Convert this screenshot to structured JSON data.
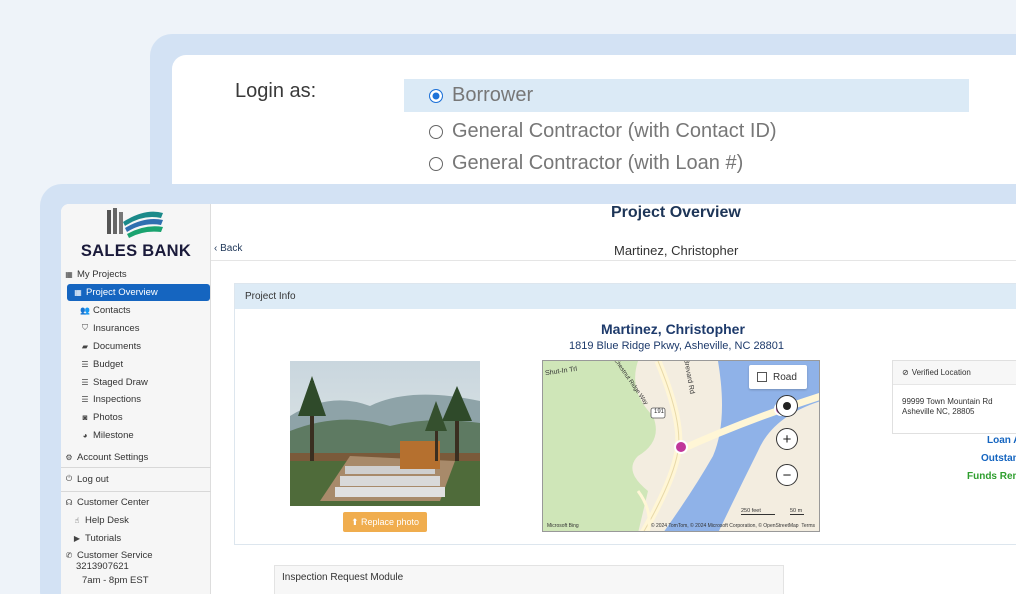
{
  "login": {
    "label": "Login as:",
    "options": [
      {
        "label": "Borrower",
        "selected": true
      },
      {
        "label": "General Contractor (with Contact ID)",
        "selected": false
      },
      {
        "label": "General Contractor (with Loan #)",
        "selected": false
      }
    ]
  },
  "brand": {
    "name": "SALES BANK"
  },
  "sidebar": {
    "items": [
      {
        "label": "My Projects",
        "icon": "grid-icon"
      },
      {
        "label": "Project Overview",
        "icon": "grid-icon",
        "active": true
      },
      {
        "label": "Contacts",
        "icon": "users-icon"
      },
      {
        "label": "Insurances",
        "icon": "shield-icon"
      },
      {
        "label": "Documents",
        "icon": "folder-icon"
      },
      {
        "label": "Budget",
        "icon": "list-icon"
      },
      {
        "label": "Staged Draw",
        "icon": "list-icon"
      },
      {
        "label": "Inspections",
        "icon": "list-icon"
      },
      {
        "label": "Photos",
        "icon": "camera-icon"
      },
      {
        "label": "Milestone",
        "icon": "dashboard-icon"
      },
      {
        "label": "Account Settings",
        "icon": "gear-icon"
      },
      {
        "label": "Log out",
        "icon": "power-icon"
      },
      {
        "label": "Customer Center",
        "icon": "headset-icon"
      },
      {
        "label": "Help Desk",
        "icon": "hand-icon"
      },
      {
        "label": "Tutorials",
        "icon": "play-icon"
      }
    ],
    "customer_service": {
      "label": "Customer Service",
      "phone": "3213907621",
      "hours": "7am - 8pm EST"
    }
  },
  "main": {
    "title": "Project Overview",
    "back_label": "Back",
    "client_name": "Martinez, Christopher"
  },
  "project_info": {
    "header": "Project Info",
    "name": "Martinez, Christopher",
    "address": "1819 Blue Ridge Pkwy, Asheville, NC 28801",
    "replace_photo_label": "Replace photo",
    "map": {
      "road_label": "Road",
      "streets": [
        "Shut-In Trl",
        "Brevard Rd",
        "Chestnut Ridge Way"
      ],
      "route_shield": "191",
      "scale_feet": "250 feet",
      "scale_m": "50 m",
      "provider": "Microsoft Bing",
      "copyright": "© 2024 TomTom, © 2024 Microsoft Corporation, © OpenStreetMap",
      "terms": "Terms"
    },
    "verified": {
      "label": "Verified Location",
      "line1": "99999 Town Mountain Rd",
      "line2": "Asheville NC, 28805"
    },
    "stats": {
      "loan": "Loan A",
      "outstanding": "Outstan",
      "funds": "Funds Rem"
    }
  },
  "inspection": {
    "header": "Inspection Request Module"
  },
  "colors": {
    "primary": "#1565c0",
    "navy": "#1d3a6b",
    "orange": "#f0ad4e",
    "green": "#2e9e2e"
  }
}
